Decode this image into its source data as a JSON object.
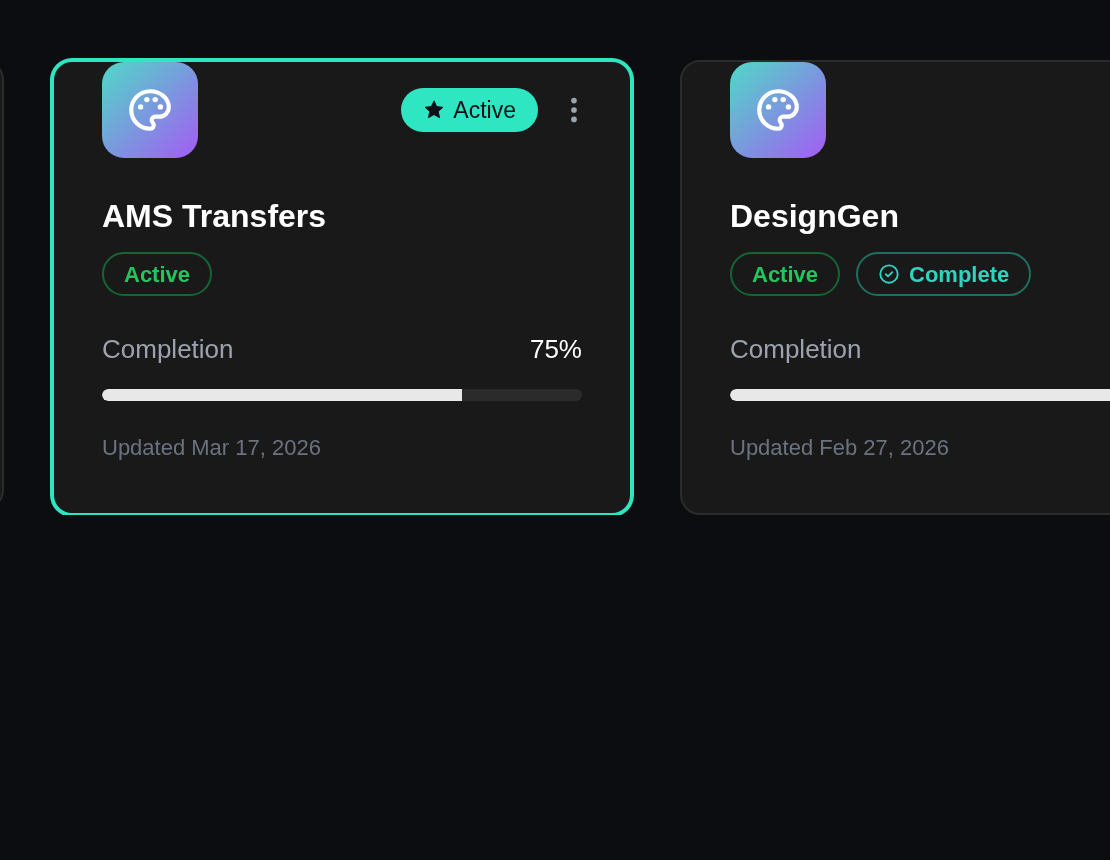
{
  "cards": [
    {
      "title": "AMS Transfers",
      "selected": true,
      "featured_badge": {
        "label": "Active"
      },
      "tags": [
        {
          "label": "Active",
          "kind": "status"
        }
      ],
      "progress": {
        "label": "Completion",
        "reading": "75%",
        "level": 0.75
      },
      "updated": "Updated Mar 17, 2026"
    },
    {
      "title": "DesignGen",
      "selected": false,
      "tags": [
        {
          "label": "Active",
          "kind": "status"
        },
        {
          "label": "Complete",
          "kind": "complete"
        }
      ],
      "progress": {
        "label": "Completion",
        "level": 1
      },
      "updated": "Updated Feb 27, 2026"
    }
  ]
}
